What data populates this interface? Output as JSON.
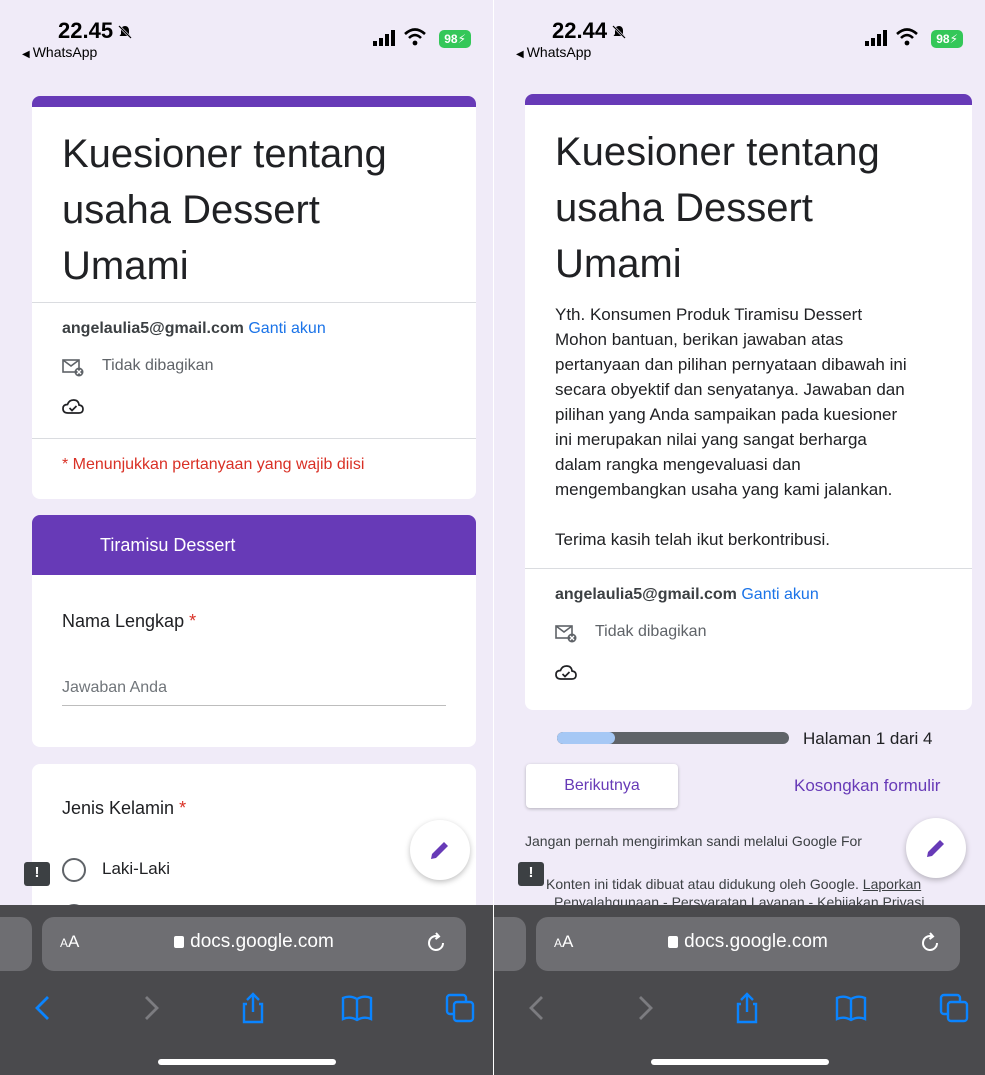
{
  "colors": {
    "accent": "#673ab7",
    "page_bg": "#f0ebf8",
    "required": "#d93025",
    "link": "#1a73e8",
    "battery": "#34c759",
    "progress_fill": "#a6c8f5"
  },
  "left": {
    "status": {
      "time": "22.45",
      "back_app": "WhatsApp",
      "battery": "98"
    },
    "header": {
      "title_lines": [
        "Kuesioner tentang",
        "usaha Dessert",
        "Umami"
      ],
      "email": "angelaulia5@gmail.com",
      "switch_account": "Ganti akun",
      "not_shared": "Tidak dibagikan",
      "required_note": "* Menunjukkan pertanyaan yang wajib diisi"
    },
    "section_title": "Tiramisu Dessert",
    "q1": {
      "label": "Nama Lengkap",
      "required_mark": "*",
      "placeholder": "Jawaban Anda"
    },
    "q2": {
      "label": "Jenis Kelamin",
      "required_mark": "*",
      "options": [
        "Laki-Laki"
      ]
    },
    "browser": {
      "aa_small": "A",
      "aa_big": "A",
      "domain": "docs.google.com"
    }
  },
  "right": {
    "status": {
      "time": "22.44",
      "back_app": "WhatsApp",
      "battery": "98"
    },
    "header": {
      "title_lines": [
        "Kuesioner tentang",
        "usaha Dessert",
        "Umami"
      ],
      "description_lines": [
        "Yth. Konsumen Produk Tiramisu Dessert",
        "Mohon bantuan, berikan jawaban atas",
        "pertanyaan dan pilihan pernyataan dibawah ini",
        "secara obyektif dan senyatanya. Jawaban dan",
        "pilihan yang Anda sampaikan pada kuesioner",
        "ini merupakan nilai yang sangat berharga",
        "dalam rangka mengevaluasi dan",
        "mengembangkan usaha yang kami jalankan."
      ],
      "thanks": "Terima kasih telah ikut berkontribusi.",
      "email": "angelaulia5@gmail.com",
      "switch_account": "Ganti akun",
      "not_shared": "Tidak dibagikan"
    },
    "progress": {
      "fraction": 0.25,
      "label": "Halaman 1 dari 4"
    },
    "next_button": "Berikutnya",
    "clear_form": "Kosongkan formulir",
    "password_warning": "Jangan pernah mengirimkan sandi melalui Google For",
    "footer": {
      "not_endorsed": "Konten ini tidak dibuat atau didukung oleh Google.",
      "report_abuse": "Laporkan",
      "line2_a": "Penyalahgunaan",
      "sep": " - ",
      "terms": "Persyaratan Layanan",
      "privacy": "Kebijakan Privasi"
    },
    "browser": {
      "aa_small": "A",
      "aa_big": "A",
      "domain": "docs.google.com"
    }
  }
}
